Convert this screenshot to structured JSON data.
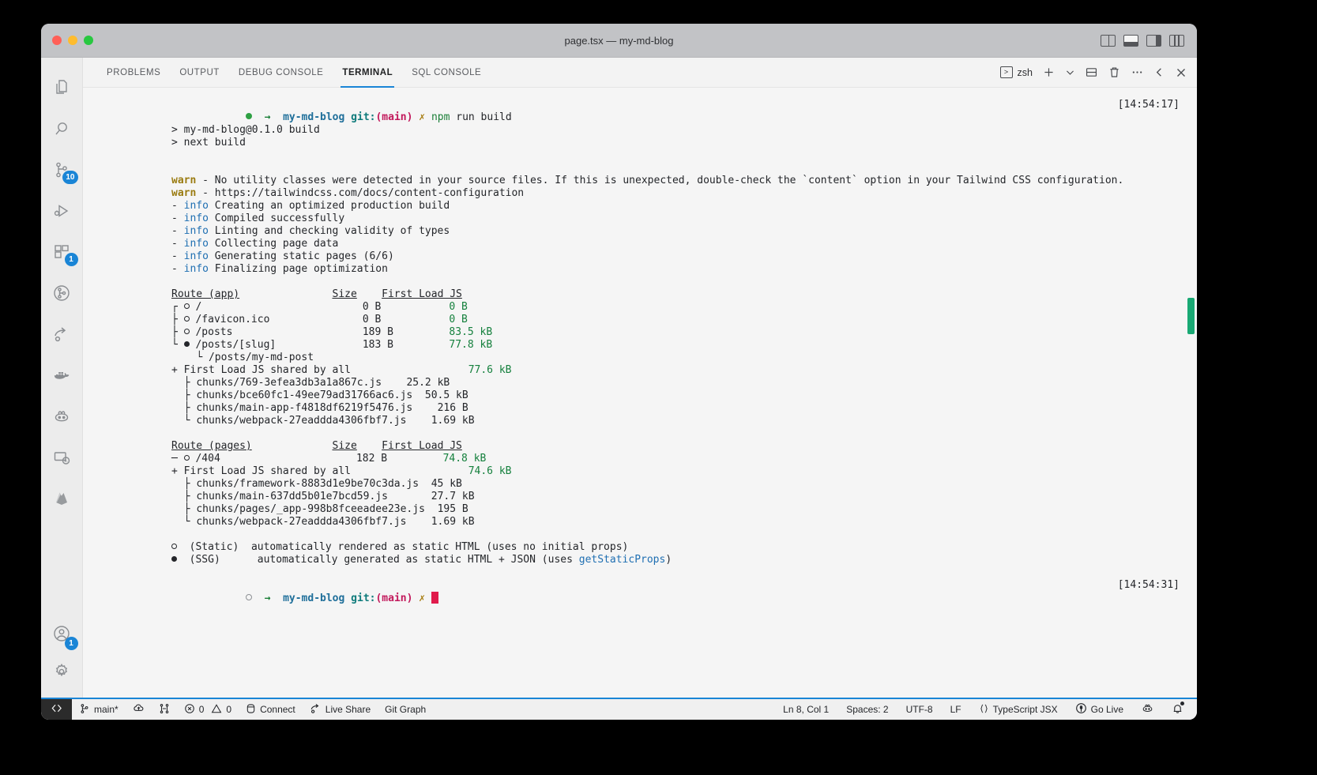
{
  "window": {
    "title": "page.tsx — my-md-blog",
    "traffic_lights": [
      "close-red",
      "minimize-yellow",
      "maximize-green"
    ],
    "layout_buttons": [
      "toggle-primary-sidebar",
      "toggle-panel",
      "toggle-secondary-sidebar",
      "customize-layout"
    ]
  },
  "activity_bar": {
    "items": [
      {
        "name": "explorer",
        "icon": "files-icon",
        "badge": ""
      },
      {
        "name": "search",
        "icon": "search-icon",
        "badge": ""
      },
      {
        "name": "source-control",
        "icon": "source-control-icon",
        "badge": "10"
      },
      {
        "name": "run-and-debug",
        "icon": "run-debug-icon",
        "badge": ""
      },
      {
        "name": "extensions",
        "icon": "extensions-icon",
        "badge": "1"
      },
      {
        "name": "git-graph",
        "icon": "git-graph-icon",
        "badge": ""
      },
      {
        "name": "share",
        "icon": "share-icon",
        "badge": ""
      },
      {
        "name": "docker",
        "icon": "docker-icon",
        "badge": ""
      },
      {
        "name": "copilot",
        "icon": "copilot-icon",
        "badge": ""
      },
      {
        "name": "remote-explorer",
        "icon": "remote-monitor-icon",
        "badge": ""
      },
      {
        "name": "firebase",
        "icon": "firebase-icon",
        "badge": ""
      }
    ],
    "bottom_items": [
      {
        "name": "accounts",
        "icon": "account-icon",
        "badge": "1"
      },
      {
        "name": "settings",
        "icon": "gear-icon",
        "badge": ""
      }
    ]
  },
  "panel": {
    "tabs": [
      {
        "label": "PROBLEMS",
        "active": false
      },
      {
        "label": "OUTPUT",
        "active": false
      },
      {
        "label": "DEBUG CONSOLE",
        "active": false
      },
      {
        "label": "TERMINAL",
        "active": true
      },
      {
        "label": "SQL CONSOLE",
        "active": false
      }
    ],
    "toolbar": {
      "shell_label": "zsh",
      "new_terminal": "+",
      "split_terminal": "split-terminal-icon",
      "kill_terminal": "trash-icon",
      "more_actions": "…",
      "chevron_down": "chevron-down-icon",
      "previous": "chevron-left-icon",
      "close": "close-icon"
    }
  },
  "terminal": {
    "prompt": {
      "cwd": "my-md-blog",
      "git_prefix": "git:",
      "branch": "(main)",
      "dirty_mark": "✗",
      "arrow": "→"
    },
    "command": {
      "bin": "npm",
      "args": "run build"
    },
    "timestamps": {
      "start": "[14:54:17]",
      "end": "[14:54:31]"
    },
    "script_lines": [
      "> my-md-blog@0.1.0 build",
      "> next build"
    ],
    "warn_label": "warn",
    "warn_lines": [
      "- No utility classes were detected in your source files. If this is unexpected, double-check the `content` option in your Tailwind CSS configuration.",
      "- https://tailwindcss.com/docs/content-configuration"
    ],
    "info_label": "info",
    "info_lines": [
      "Creating an optimized production build",
      "Compiled successfully",
      "Linting and checking validity of types",
      "Collecting page data",
      "Generating static pages (6/6)",
      "Finalizing page optimization"
    ],
    "table_app": {
      "headers": [
        "Route (app)",
        "Size",
        "First Load JS"
      ],
      "rows": [
        {
          "tree": "┌",
          "marker": "static",
          "route": "/",
          "size": "0 B",
          "first_load": "0 B"
        },
        {
          "tree": "├",
          "marker": "static",
          "route": "/favicon.ico",
          "size": "0 B",
          "first_load": "0 B"
        },
        {
          "tree": "├",
          "marker": "static",
          "route": "/posts",
          "size": "189 B",
          "first_load": "83.5 kB"
        },
        {
          "tree": "└",
          "marker": "ssg",
          "route": "/posts/[slug]",
          "size": "183 B",
          "first_load": "77.8 kB"
        }
      ],
      "child_route": "└ /posts/my-md-post",
      "shared_label": "+ First Load JS shared by all",
      "shared_total": "77.6 kB",
      "chunks": [
        {
          "tree": "├",
          "name": "chunks/769-3efea3db3a1a867c.js",
          "size": "25.2 kB"
        },
        {
          "tree": "├",
          "name": "chunks/bce60fc1-49ee79ad31766ac6.js",
          "size": "50.5 kB"
        },
        {
          "tree": "├",
          "name": "chunks/main-app-f4818df6219f5476.js",
          "size": "216 B"
        },
        {
          "tree": "└",
          "name": "chunks/webpack-27eaddda4306fbf7.js",
          "size": "1.69 kB"
        }
      ]
    },
    "table_pages": {
      "headers": [
        "Route (pages)",
        "Size",
        "First Load JS"
      ],
      "rows": [
        {
          "tree": "─",
          "marker": "static",
          "route": "/404",
          "size": "182 B",
          "first_load": "74.8 kB"
        }
      ],
      "shared_label": "+ First Load JS shared by all",
      "shared_total": "74.6 kB",
      "chunks": [
        {
          "tree": "├",
          "name": "chunks/framework-8883d1e9be70c3da.js",
          "size": "45 kB"
        },
        {
          "tree": "├",
          "name": "chunks/main-637dd5b01e7bcd59.js",
          "size": "27.7 kB"
        },
        {
          "tree": "├",
          "name": "chunks/pages/_app-998b8fceeadee23e.js",
          "size": "195 B"
        },
        {
          "tree": "└",
          "name": "chunks/webpack-27eaddda4306fbf7.js",
          "size": "1.69 kB"
        }
      ]
    },
    "legend": [
      {
        "marker": "static",
        "key": "(Static)",
        "desc": "automatically rendered as static HTML (uses no initial props)",
        "link": ""
      },
      {
        "marker": "ssg",
        "key": "(SSG)",
        "desc": "automatically generated as static HTML + JSON (uses ",
        "link": "getStaticProps",
        "tail": ")"
      }
    ]
  },
  "status_bar": {
    "remote_icon": "remote-window-icon",
    "left_items": [
      {
        "name": "branch",
        "icon": "source-control-icon",
        "label": "main*"
      },
      {
        "name": "sync",
        "icon": "sync-cloud-icon",
        "label": ""
      },
      {
        "name": "git-actions",
        "icon": "git-compare-icon",
        "label": ""
      },
      {
        "name": "errors",
        "icon": "error-icon",
        "label": "0"
      },
      {
        "name": "warnings",
        "icon": "warning-icon",
        "label": "0"
      },
      {
        "name": "database-connect",
        "icon": "database-icon",
        "label": "Connect"
      },
      {
        "name": "live-share",
        "icon": "live-share-icon",
        "label": "Live Share"
      },
      {
        "name": "git-graph",
        "icon": "",
        "label": "Git Graph"
      }
    ],
    "right_items": [
      {
        "name": "cursor-position",
        "icon": "",
        "label": "Ln 8, Col 1"
      },
      {
        "name": "indentation",
        "icon": "",
        "label": "Spaces: 2"
      },
      {
        "name": "encoding",
        "icon": "",
        "label": "UTF-8"
      },
      {
        "name": "eol",
        "icon": "",
        "label": "LF"
      },
      {
        "name": "language-mode",
        "icon": "braces-icon",
        "label": "TypeScript JSX"
      },
      {
        "name": "go-live",
        "icon": "broadcast-icon",
        "label": "Go Live"
      },
      {
        "name": "copilot-status",
        "icon": "copilot-icon",
        "label": ""
      },
      {
        "name": "notifications",
        "icon": "bell-icon",
        "label": ""
      }
    ]
  },
  "colors": {
    "accent": "#1a85d6",
    "green": "#1a7f37",
    "warn": "#9a7b10",
    "info": "#1f6fb2",
    "branch_red": "#c2185b",
    "cursor": "#e01b4c"
  }
}
